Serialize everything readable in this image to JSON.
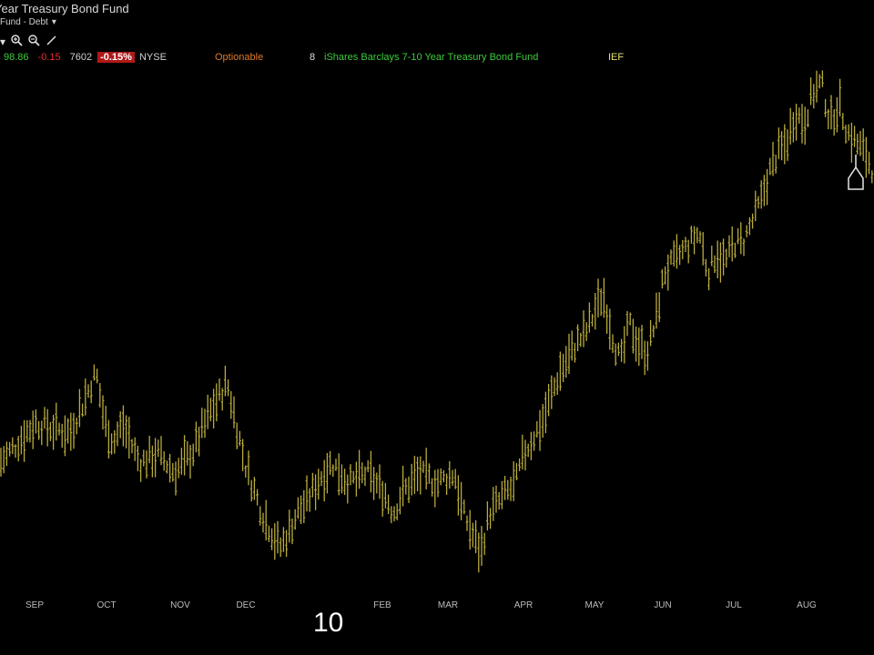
{
  "header": {
    "title_fragment": "Year Treasury Bond Fund",
    "subtitle_fragment": "Fund - Debt",
    "dropdown_glyph": "▾"
  },
  "quote": {
    "last": "98.86",
    "change": "-0.15",
    "volume": "7602",
    "change_pct": "-0.15%",
    "exchange": "NYSE",
    "optionable": "Optionable",
    "flag": "8",
    "name": "iShares Barclays 7-10 Year Treasury Bond Fund",
    "symbol": "IEF"
  },
  "icons": [
    "chevron-down-icon",
    "zoom-in-icon",
    "zoom-out-icon",
    "draw-line-icon",
    "drawing-anchor-icon"
  ],
  "colors": {
    "background": "#000000",
    "bars": "#b8ab3a",
    "last_up": "#3ccc3c",
    "change_down": "#e23030",
    "pct_badge": "#b01818",
    "optionable": "#e07a28",
    "symbol": "#e8e070"
  },
  "chart_data": {
    "type": "line",
    "style": "ohlc-bars",
    "title": "",
    "xlabel": "",
    "ylabel": "",
    "year_marker": "10",
    "months": [
      "SEP",
      "OCT",
      "NOV",
      "DEC",
      "FEB",
      "MAR",
      "APR",
      "MAY",
      "JUN",
      "JUL",
      "AUG"
    ],
    "x": [
      0,
      0.04,
      0.08,
      0.1,
      0.11,
      0.12,
      0.13,
      0.14,
      0.16,
      0.18,
      0.2,
      0.22,
      0.24,
      0.26,
      0.27,
      0.28,
      0.3,
      0.32,
      0.33,
      0.34,
      0.35,
      0.37,
      0.38,
      0.4,
      0.42,
      0.44,
      0.45,
      0.46,
      0.48,
      0.5,
      0.52,
      0.53,
      0.54,
      0.55,
      0.56,
      0.57,
      0.58,
      0.59,
      0.6,
      0.62,
      0.64,
      0.66,
      0.67,
      0.68,
      0.69,
      0.7,
      0.71,
      0.72,
      0.73,
      0.74,
      0.75,
      0.76,
      0.78,
      0.8,
      0.81,
      0.82,
      0.83,
      0.84,
      0.85,
      0.86,
      0.87,
      0.88,
      0.89,
      0.9,
      0.91,
      0.92,
      0.93,
      0.94,
      0.95,
      0.96,
      0.97,
      0.98,
      0.99,
      1.0
    ],
    "y": [
      0.22,
      0.3,
      0.28,
      0.36,
      0.4,
      0.3,
      0.26,
      0.3,
      0.22,
      0.24,
      0.2,
      0.24,
      0.32,
      0.38,
      0.3,
      0.22,
      0.12,
      0.05,
      0.08,
      0.12,
      0.14,
      0.2,
      0.22,
      0.18,
      0.2,
      0.16,
      0.12,
      0.16,
      0.2,
      0.18,
      0.2,
      0.12,
      0.08,
      0.04,
      0.12,
      0.14,
      0.16,
      0.18,
      0.24,
      0.3,
      0.4,
      0.46,
      0.48,
      0.52,
      0.56,
      0.48,
      0.42,
      0.5,
      0.46,
      0.44,
      0.5,
      0.6,
      0.64,
      0.68,
      0.6,
      0.64,
      0.62,
      0.66,
      0.66,
      0.7,
      0.74,
      0.8,
      0.84,
      0.86,
      0.92,
      0.9,
      0.96,
      0.98,
      0.9,
      0.94,
      0.88,
      0.86,
      0.84,
      0.8
    ],
    "ylim": [
      0,
      1
    ],
    "value_scale": "normalized (no price axis printed)",
    "grid": false,
    "legend": "none"
  }
}
